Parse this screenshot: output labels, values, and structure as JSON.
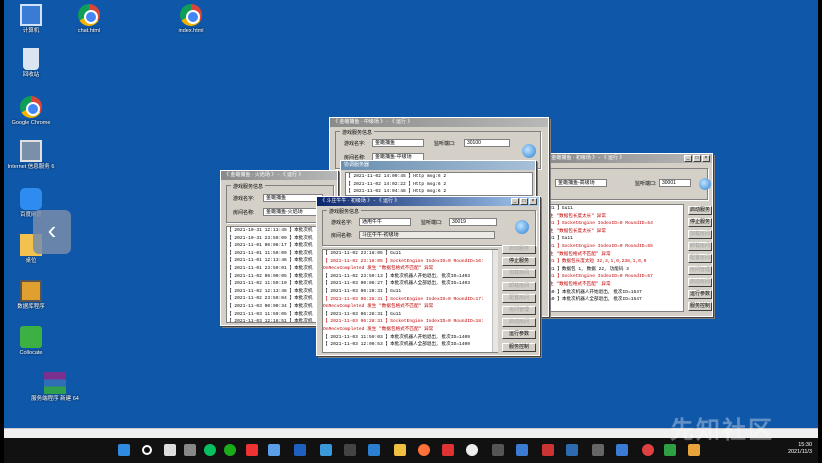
{
  "desktop_icons": [
    {
      "label": "计算机",
      "icon": "computer-icon"
    },
    {
      "label": "chat.html",
      "icon": "chrome-icon"
    },
    {
      "label": "index.html",
      "icon": "chrome-icon"
    },
    {
      "label": "回收站",
      "icon": "recycle-bin-icon"
    },
    {
      "label": "Google Chrome",
      "icon": "chrome-icon"
    },
    {
      "label": "Internet 信息服务 6",
      "icon": "iis-icon"
    },
    {
      "label": "百度网盘",
      "icon": "baidu-netdisk-icon"
    },
    {
      "label": "桌位",
      "icon": "folder-icon"
    },
    {
      "label": "数据库程序",
      "icon": "database-icon"
    },
    {
      "label": "Collocate",
      "icon": "collocate-icon"
    },
    {
      "label": "服务端程序 新建 64",
      "icon": "winrar-icon"
    }
  ],
  "windows": {
    "right": {
      "title": "《 金蟾捕鱼 · 初级场 》 - 《 运行 》",
      "game_name": "金蟾捕鱼-高级场",
      "port_label": "监听端口:",
      "port": "30001",
      "log": [
        {
          "t": "31 】Gu11",
          "red": false
        },
        {
          "t": "生 \"数据包长度太长\" 异常",
          "red": true
        },
        {
          "t": "31 】SocketEngine IndexID=0 RoundID=54",
          "red": true
        },
        {
          "t": "生 \"数据包长度太长\" 异常",
          "red": true
        },
        {
          "t": "31 】Gu11",
          "red": false
        },
        {
          "t": "31 】SocketEngine IndexID=0 RoundID=55",
          "red": true
        },
        {
          "t": "生 \"数据包格式不匹配\" 异常",
          "red": true
        },
        {
          "t": "31 】数据包长度太短 32,3,1,0,238,1,0,0",
          "red": true
        },
        {
          "t": "31 】数据包 1, 数据 22, 功能码 3",
          "red": false
        },
        {
          "t": "31 】SocketEngine IndexID=0 RoundID=57",
          "red": true
        },
        {
          "t": "生 \"数据包格式不匹配\" 异常",
          "red": true
        },
        {
          "t": "50 】本批次机器人开始退出, 批次ID=1547",
          "red": false
        },
        {
          "t": "50 】本批次机器人全部退出, 批次ID=1547",
          "red": false
        }
      ],
      "buttons": [
        "启动服务",
        "停止服务",
        "加载房间",
        "卸载房间",
        "配置房间",
        "房间管理",
        "启动房间",
        "运行参数",
        "服务控制"
      ]
    },
    "back_mid": {
      "title": "《 金蟾捕鱼 · 中级场 》 - 《 运行 》",
      "section": "游戏服务信息",
      "game_label": "游戏名字:",
      "game_name": "金蟾捕鱼",
      "room_label": "房间名称:",
      "room_name": "金蟾捕鱼-中级场",
      "port_label": "监听端口:",
      "port": "30100"
    },
    "popup": {
      "title": "协调服务器",
      "log": [
        {
          "t": "【 2021-11-02 14:00:45 】Http msg:6 2",
          "red": false
        },
        {
          "t": "【 2021-11-02 14:02:22 】Http msg:6 2",
          "red": false
        },
        {
          "t": "【 2021-11-02 14:04:48 】Http msg:6 2",
          "red": false
        }
      ]
    },
    "left": {
      "title": "《 金蟾捕鱼 · 火焰场 》 - 《 运行 》",
      "section": "游戏服务信息",
      "game_label": "游戏名字:",
      "game_name": "金蟾捕鱼",
      "room_label": "房间名称:",
      "room_name": "金蟾捕鱼-火焰场",
      "log": [
        {
          "t": "【 2021-10-31 12:13:45 】本批次机",
          "red": false
        },
        {
          "t": "【 2021-10-31 23:59:09 】本批次机",
          "red": false
        },
        {
          "t": "【 2021-11-01 06:06:17 】本批次机",
          "red": false
        },
        {
          "t": "【 2021-11-01 11:59:09 】本批次机",
          "red": false
        },
        {
          "t": "【 2021-11-01 12:13:46 】本批次机",
          "red": false
        },
        {
          "t": "【 2021-11-01 23:59:01 】本批次机",
          "red": false
        },
        {
          "t": "【 2021-11-02 06:00:05 】本批次机",
          "red": false
        },
        {
          "t": "【 2021-11-02 11:59:10 】本批次机",
          "red": false
        },
        {
          "t": "【 2021-11-02 12:13:46 】本批次机",
          "red": false
        },
        {
          "t": "【 2021-11-02 23:59:04 】本批次机",
          "red": false
        },
        {
          "t": "【 2021-11-03 00:00:34 】本批次机",
          "red": false
        },
        {
          "t": "【 2021-11-03 11:59:05 】本批次机",
          "red": false
        },
        {
          "t": "【 2021-11-03 12:16:51 】本批次机",
          "red": false
        }
      ]
    },
    "front": {
      "title": "《 斗庄牛牛 · 初级场 》 - 《 运行 》",
      "section": "游戏服务信息",
      "game_label": "游戏名字:",
      "game_name": "通用牛牛",
      "room_label": "房间名称:",
      "room_name": "斗庄牛牛-初级场",
      "port_label": "监听端口:",
      "port": "30019",
      "log": [
        {
          "t": "【 2021-11-02 23:18:05 】Gu11",
          "red": false
        },
        {
          "t": "【 2021-11-02 23:18:05 】SocketEngine IndexID=0 RoundID=16:",
          "red": true
        },
        {
          "t": "OnRecvCompleted 发生 \"数据包格式不匹配\" 异常",
          "red": true
        },
        {
          "t": "【 2021-11-02 23:59:13 】本批次机器人开始退出, 批次ID=1403",
          "red": false
        },
        {
          "t": "【 2021-11-03 00:06:27 】本批次机器人全部退出, 批次ID=1403",
          "red": false
        },
        {
          "t": "【 2021-11-03 06:28:31 】Gu11",
          "red": false
        },
        {
          "t": "【 2021-11-03 06:28:31 】SocketEngine IndexID=0 RoundID=17:",
          "red": true
        },
        {
          "t": "OnRecvCompleted 发生 \"数据包格式不匹配\" 异常",
          "red": true
        },
        {
          "t": "【 2021-11-03 06:28:31 】Gu11",
          "red": false
        },
        {
          "t": "【 2021-11-03 06:28:31 】SocketEngine IndexID=0 RoundID=18:",
          "red": true
        },
        {
          "t": "OnRecvCompleted 发生 \"数据包格式不匹配\" 异常",
          "red": true
        },
        {
          "t": "【 2021-11-03 11:59:03 】本批次机器人开始退出, 批次ID=1409",
          "red": false
        },
        {
          "t": "【 2021-11-03 12:09:53 】本批次机器人全部退出, 批次ID=1409",
          "red": false
        }
      ],
      "buttons": [
        {
          "label": "启动服务",
          "disabled": true
        },
        {
          "label": "停止服务",
          "disabled": false
        },
        {
          "label": "加载房间",
          "disabled": true
        },
        {
          "label": "卸载房间",
          "disabled": true
        },
        {
          "label": "配置房间",
          "disabled": true
        },
        {
          "label": "房间管理",
          "disabled": true
        },
        {
          "label": "启动房间",
          "disabled": true
        },
        {
          "label": "运行参数",
          "disabled": false
        },
        {
          "label": "服务控制",
          "disabled": false
        }
      ]
    }
  },
  "taskbar": {
    "clock_time": "15:30",
    "clock_date": "2021/11/3"
  },
  "watermark": "先知社区",
  "colors": {
    "desktop": "#0f57a8",
    "titlebar_active": "#0a246a",
    "log_error": "#c00000"
  }
}
